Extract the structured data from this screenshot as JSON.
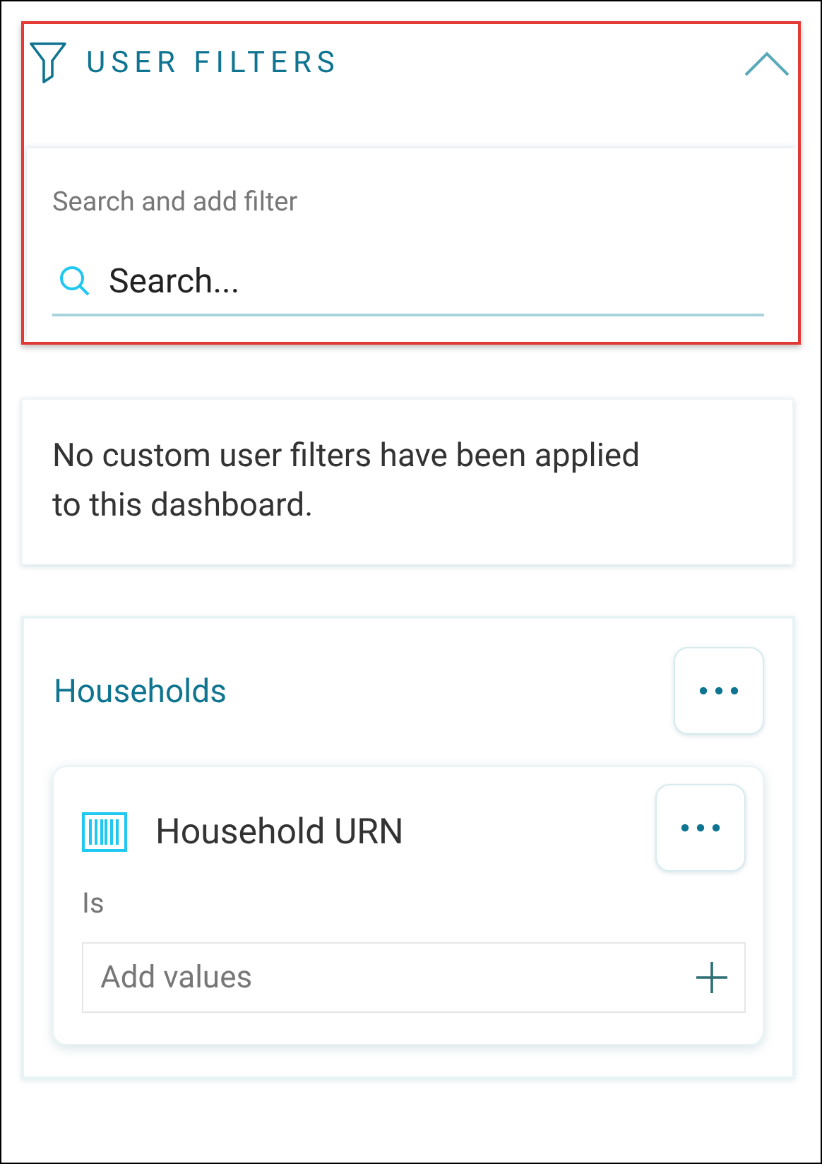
{
  "panel": {
    "title": "USER FILTERS",
    "expanded": true
  },
  "search": {
    "label": "Search and add filter",
    "placeholder": "Search..."
  },
  "notice": "No custom user filters have been applied to this dashboard.",
  "groups": [
    {
      "title": "Households",
      "filters": [
        {
          "name": "Household URN",
          "operator": "Is",
          "placeholder": "Add values"
        }
      ]
    }
  ]
}
